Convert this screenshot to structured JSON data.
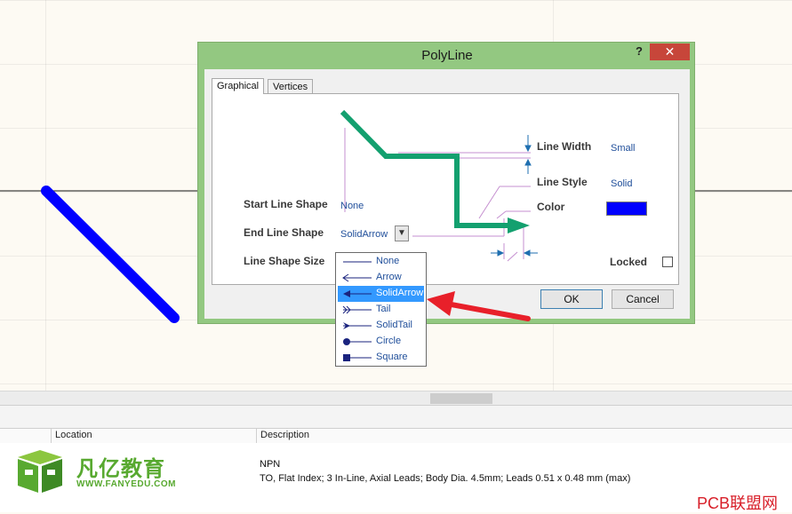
{
  "dialog": {
    "title": "PolyLine",
    "help": "?",
    "close": "✕",
    "tabs": [
      {
        "label": "Graphical",
        "active": true
      },
      {
        "label": "Vertices",
        "active": false
      }
    ],
    "fields": {
      "line_width": {
        "label": "Line Width",
        "value": "Small"
      },
      "line_style": {
        "label": "Line Style",
        "value": "Solid"
      },
      "color": {
        "label": "Color",
        "value": "#0000ff"
      },
      "start_line_shape": {
        "label": "Start Line Shape",
        "value": "None"
      },
      "end_line_shape": {
        "label": "End Line Shape",
        "value": "SolidArrow"
      },
      "line_shape_size": {
        "label": "Line Shape Size"
      },
      "locked": {
        "label": "Locked",
        "checked": false
      }
    },
    "ok_label": "OK",
    "cancel_label": "Cancel"
  },
  "end_shape_options": [
    {
      "label": "None",
      "icon": "none-line-icon"
    },
    {
      "label": "Arrow",
      "icon": "arrow-line-icon"
    },
    {
      "label": "SolidArrow",
      "icon": "solid-arrow-line-icon",
      "selected": true
    },
    {
      "label": "Tail",
      "icon": "tail-line-icon"
    },
    {
      "label": "SolidTail",
      "icon": "solid-tail-line-icon"
    },
    {
      "label": "Circle",
      "icon": "circle-line-icon"
    },
    {
      "label": "Square",
      "icon": "square-line-icon"
    }
  ],
  "grid": {
    "columns": [
      "Location",
      "Description"
    ]
  },
  "component": {
    "name": "NPN",
    "description": "TO, Flat Index; 3 In-Line, Axial Leads; Body Dia. 4.5mm; Leads 0.51 x 0.48 mm (max)"
  },
  "logo": {
    "cn": "凡亿教育",
    "en": "WWW.FANYEDU.COM"
  },
  "watermark": "PCB联盟网",
  "colors": {
    "preview_line": "#13a06f",
    "canvas_line": "#0000ff",
    "callout": "#e8202a",
    "dialog_frame": "#93c881"
  }
}
